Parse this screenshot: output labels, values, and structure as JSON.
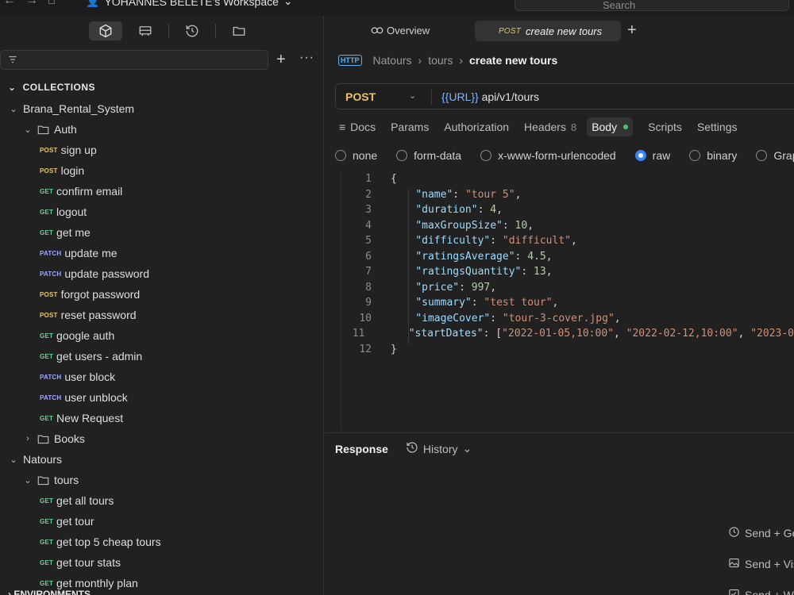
{
  "topbar": {
    "workspace": "YOHANNES BELETE's Workspace",
    "search_placeholder": "Search"
  },
  "sidebar": {
    "filter_placeholder": "",
    "collections_label": "COLLECTIONS",
    "environments_label": "ENVIRONMENTS",
    "tree": [
      {
        "kind": "collection",
        "label": "Brana_Rental_System",
        "expanded": true,
        "level": 0
      },
      {
        "kind": "folder",
        "label": "Auth",
        "expanded": true,
        "level": 1
      },
      {
        "kind": "request",
        "method": "POST",
        "label": "sign up",
        "level": 2
      },
      {
        "kind": "request",
        "method": "POST",
        "label": "login",
        "level": 2
      },
      {
        "kind": "request",
        "method": "GET",
        "label": "confirm email",
        "level": 2
      },
      {
        "kind": "request",
        "method": "GET",
        "label": "logout",
        "level": 2
      },
      {
        "kind": "request",
        "method": "GET",
        "label": "get me",
        "level": 2
      },
      {
        "kind": "request",
        "method": "PATCH",
        "label": "update me",
        "level": 2
      },
      {
        "kind": "request",
        "method": "PATCH",
        "label": "update password",
        "level": 2
      },
      {
        "kind": "request",
        "method": "POST",
        "label": "forgot password",
        "level": 2
      },
      {
        "kind": "request",
        "method": "POST",
        "label": "reset password",
        "level": 2
      },
      {
        "kind": "request",
        "method": "GET",
        "label": "google auth",
        "level": 2
      },
      {
        "kind": "request",
        "method": "GET",
        "label": "get users - admin",
        "level": 2
      },
      {
        "kind": "request",
        "method": "PATCH",
        "label": "user block",
        "level": 2
      },
      {
        "kind": "request",
        "method": "PATCH",
        "label": "user unblock",
        "level": 2
      },
      {
        "kind": "request",
        "method": "GET",
        "label": "New Request",
        "level": 2
      },
      {
        "kind": "folder",
        "label": "Books",
        "expanded": false,
        "level": 1
      },
      {
        "kind": "collection",
        "label": "Natours",
        "expanded": true,
        "level": 0
      },
      {
        "kind": "folder",
        "label": "tours",
        "expanded": true,
        "level": 1
      },
      {
        "kind": "request",
        "method": "GET",
        "label": "get all tours",
        "level": 2
      },
      {
        "kind": "request",
        "method": "GET",
        "label": "get tour",
        "level": 2
      },
      {
        "kind": "request",
        "method": "GET",
        "label": "get top 5 cheap tours",
        "level": 2
      },
      {
        "kind": "request",
        "method": "GET",
        "label": "get tour stats",
        "level": 2
      },
      {
        "kind": "request",
        "method": "GET",
        "label": "get monthly plan",
        "level": 2
      }
    ]
  },
  "tabs": {
    "overview": "Overview",
    "active_method": "POST",
    "active_label": "create new tours"
  },
  "breadcrumb": {
    "http": "HTTP",
    "parts": [
      "Natours",
      "tours"
    ],
    "current": "create new tours"
  },
  "request": {
    "method": "POST",
    "url_var": "{{URL}}",
    "url_path": " api/v1/tours"
  },
  "req_tabs": {
    "docs": "Docs",
    "params": "Params",
    "authorization": "Authorization",
    "headers": "Headers",
    "headers_count": "8",
    "body": "Body",
    "scripts": "Scripts",
    "settings": "Settings"
  },
  "body_types": [
    "none",
    "form-data",
    "x-www-form-urlencoded",
    "raw",
    "binary",
    "GraphQL"
  ],
  "body_selected": "raw",
  "editor": {
    "line_numbers": [
      "1",
      "2",
      "3",
      "4",
      "5",
      "6",
      "7",
      "8",
      "9",
      "10",
      "11",
      "12"
    ],
    "lines": [
      [
        {
          "c": "p",
          "t": "{"
        }
      ],
      [
        {
          "c": "p",
          "t": "    "
        },
        {
          "c": "k",
          "t": "\"name\""
        },
        {
          "c": "p",
          "t": ": "
        },
        {
          "c": "s",
          "t": "\"tour 5\""
        },
        {
          "c": "p",
          "t": ","
        }
      ],
      [
        {
          "c": "p",
          "t": "    "
        },
        {
          "c": "k",
          "t": "\"duration\""
        },
        {
          "c": "p",
          "t": ": "
        },
        {
          "c": "n",
          "t": "4"
        },
        {
          "c": "p",
          "t": ","
        }
      ],
      [
        {
          "c": "p",
          "t": "    "
        },
        {
          "c": "k",
          "t": "\"maxGroupSize\""
        },
        {
          "c": "p",
          "t": ": "
        },
        {
          "c": "n",
          "t": "10"
        },
        {
          "c": "p",
          "t": ","
        }
      ],
      [
        {
          "c": "p",
          "t": "    "
        },
        {
          "c": "k",
          "t": "\"difficulty\""
        },
        {
          "c": "p",
          "t": ": "
        },
        {
          "c": "s",
          "t": "\"difficult\""
        },
        {
          "c": "p",
          "t": ","
        }
      ],
      [
        {
          "c": "p",
          "t": "    "
        },
        {
          "c": "k",
          "t": "\"ratingsAverage\""
        },
        {
          "c": "p",
          "t": ": "
        },
        {
          "c": "n",
          "t": "4.5"
        },
        {
          "c": "p",
          "t": ","
        }
      ],
      [
        {
          "c": "p",
          "t": "    "
        },
        {
          "c": "k",
          "t": "\"ratingsQuantity\""
        },
        {
          "c": "p",
          "t": ": "
        },
        {
          "c": "n",
          "t": "13"
        },
        {
          "c": "p",
          "t": ","
        }
      ],
      [
        {
          "c": "p",
          "t": "    "
        },
        {
          "c": "k",
          "t": "\"price\""
        },
        {
          "c": "p",
          "t": ": "
        },
        {
          "c": "n",
          "t": "997"
        },
        {
          "c": "p",
          "t": ","
        }
      ],
      [
        {
          "c": "p",
          "t": "    "
        },
        {
          "c": "k",
          "t": "\"summary\""
        },
        {
          "c": "p",
          "t": ": "
        },
        {
          "c": "s",
          "t": "\"test tour\""
        },
        {
          "c": "p",
          "t": ","
        }
      ],
      [
        {
          "c": "p",
          "t": "    "
        },
        {
          "c": "k",
          "t": "\"imageCover\""
        },
        {
          "c": "p",
          "t": ": "
        },
        {
          "c": "s",
          "t": "\"tour-3-cover.jpg\""
        },
        {
          "c": "p",
          "t": ","
        }
      ],
      [
        {
          "c": "p",
          "t": "    "
        },
        {
          "c": "k",
          "t": "\"startDates\""
        },
        {
          "c": "p",
          "t": ": ["
        },
        {
          "c": "s",
          "t": "\"2022-01-05,10:00\""
        },
        {
          "c": "p",
          "t": ", "
        },
        {
          "c": "s",
          "t": "\"2022-02-12,10:00\""
        },
        {
          "c": "p",
          "t": ", "
        },
        {
          "c": "s",
          "t": "\"2023-0"
        }
      ],
      [
        {
          "c": "p",
          "t": "}"
        }
      ]
    ]
  },
  "response": {
    "label": "Response",
    "history": "History"
  },
  "send_actions": [
    "Send + Ge",
    "Send + Vis",
    "Send + Wr"
  ],
  "colors": {
    "post": "#e8c36b",
    "get": "#6fcf97",
    "patch": "#9ea6ff",
    "accent": "#3b82f6",
    "body_dot": "#49c17a"
  }
}
